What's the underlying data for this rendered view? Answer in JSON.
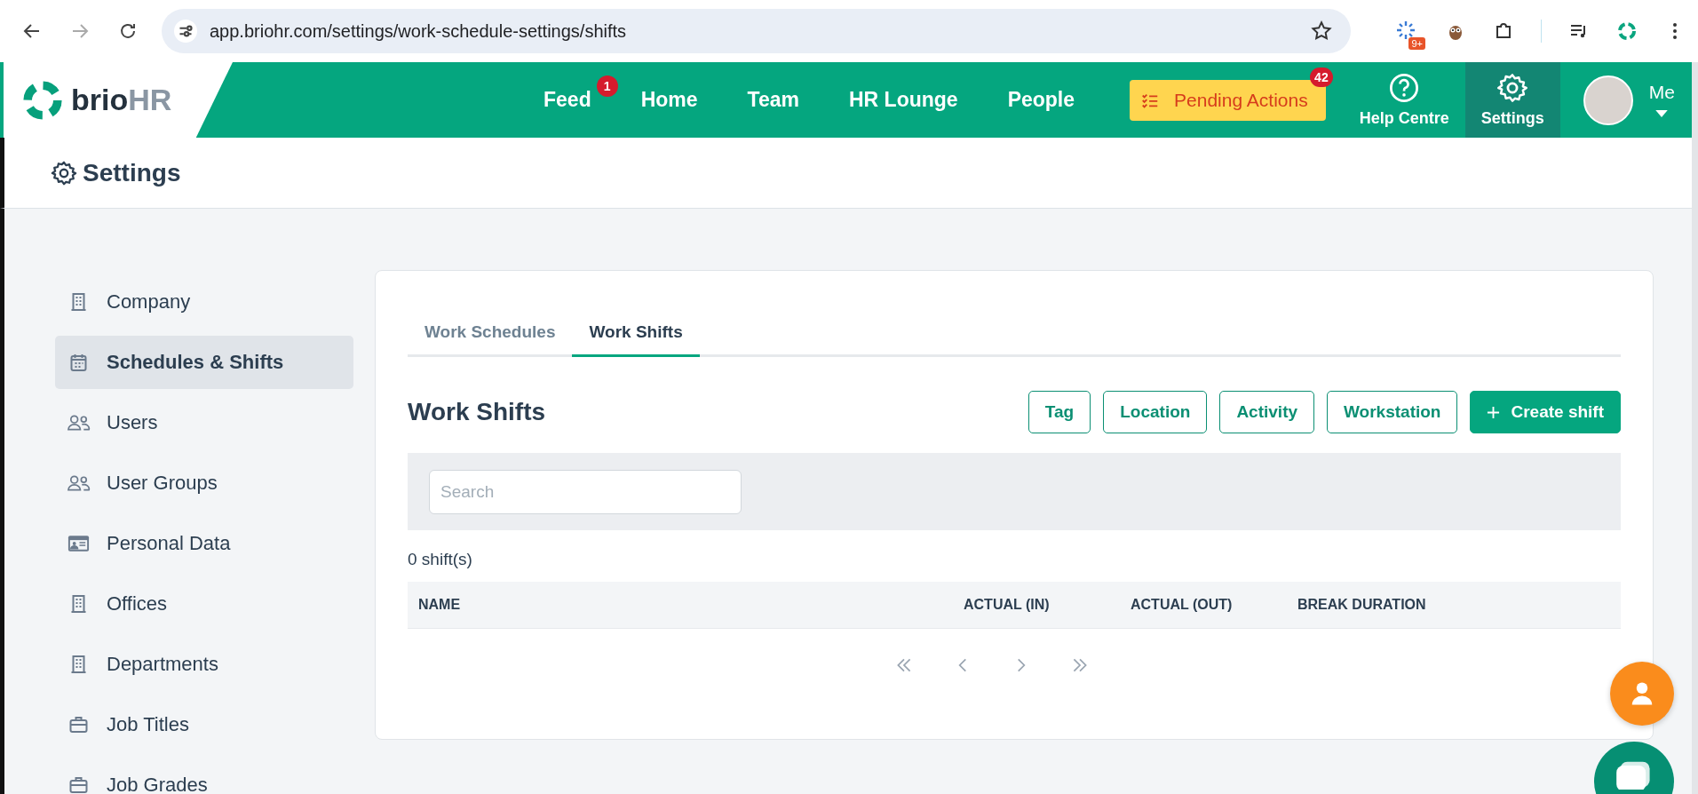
{
  "browser": {
    "url": "app.briohr.com/settings/work-schedule-settings/shifts",
    "extension_badge": "9+"
  },
  "nav": {
    "logo": {
      "brand": "brio",
      "suffix": "HR"
    },
    "items": [
      {
        "label": "Feed",
        "badge": "1"
      },
      {
        "label": "Home"
      },
      {
        "label": "Team"
      },
      {
        "label": "HR Lounge"
      },
      {
        "label": "People"
      }
    ],
    "pending": {
      "label": "Pending Actions",
      "badge": "42"
    },
    "icon_tabs": [
      {
        "label": "Help Centre",
        "kind": "help",
        "selected": false
      },
      {
        "label": "Settings",
        "kind": "gear",
        "selected": true
      }
    ],
    "profile": {
      "label": "Me"
    }
  },
  "page_title": "Settings",
  "sidebar": {
    "items": [
      {
        "label": "Company",
        "kind": "building",
        "selected": false
      },
      {
        "label": "Schedules & Shifts",
        "kind": "calendar",
        "selected": true
      },
      {
        "label": "Users",
        "kind": "users",
        "selected": false
      },
      {
        "label": "User Groups",
        "kind": "users",
        "selected": false
      },
      {
        "label": "Personal Data",
        "kind": "idcard",
        "selected": false
      },
      {
        "label": "Offices",
        "kind": "building",
        "selected": false
      },
      {
        "label": "Departments",
        "kind": "building",
        "selected": false
      },
      {
        "label": "Job Titles",
        "kind": "briefcase",
        "selected": false
      },
      {
        "label": "Job Grades",
        "kind": "briefcase",
        "selected": false
      }
    ]
  },
  "tabs": [
    {
      "label": "Work Schedules",
      "selected": false
    },
    {
      "label": "Work Shifts",
      "selected": true
    }
  ],
  "section_title": "Work Shifts",
  "buttons": [
    {
      "label": "Tag",
      "kind": "outline"
    },
    {
      "label": "Location",
      "kind": "outline"
    },
    {
      "label": "Activity",
      "kind": "outline"
    },
    {
      "label": "Workstation",
      "kind": "outline"
    },
    {
      "label": "Create shift",
      "kind": "primary"
    }
  ],
  "search": {
    "placeholder": "Search"
  },
  "count": "0 shift(s)",
  "table": {
    "columns": [
      "NAME",
      "ACTUAL (IN)",
      "ACTUAL (OUT)",
      "BREAK DURATION"
    ]
  }
}
